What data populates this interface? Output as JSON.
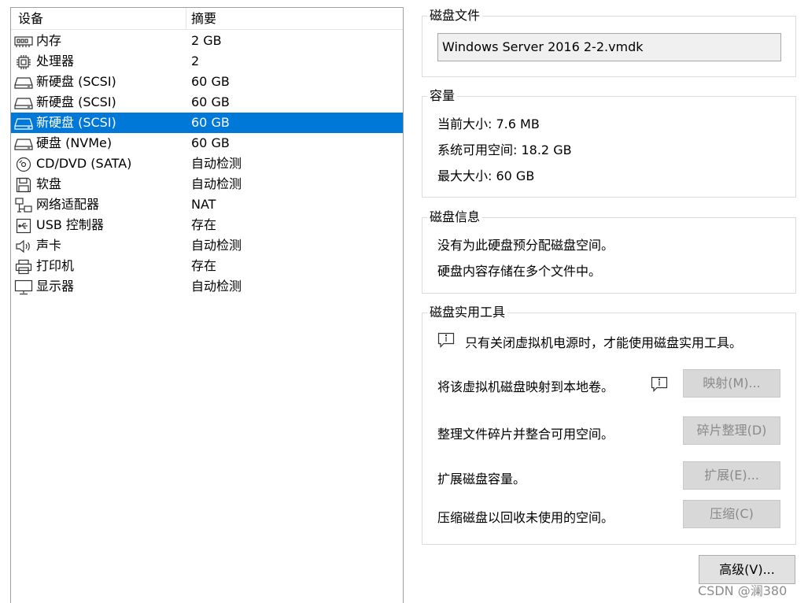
{
  "device_list": {
    "header": {
      "device": "设备",
      "summary": "摘要"
    },
    "rows": [
      {
        "icon": "memory-icon",
        "name": "内存",
        "summary": "2 GB",
        "selected": false
      },
      {
        "icon": "processor-icon",
        "name": "处理器",
        "summary": "2",
        "selected": false
      },
      {
        "icon": "hard-disk-icon",
        "name": "新硬盘 (SCSI)",
        "summary": "60 GB",
        "selected": false
      },
      {
        "icon": "hard-disk-icon",
        "name": "新硬盘 (SCSI)",
        "summary": "60 GB",
        "selected": false
      },
      {
        "icon": "hard-disk-icon",
        "name": "新硬盘 (SCSI)",
        "summary": "60 GB",
        "selected": true
      },
      {
        "icon": "hard-disk-icon",
        "name": "硬盘 (NVMe)",
        "summary": "60 GB",
        "selected": false
      },
      {
        "icon": "cd-dvd-icon",
        "name": "CD/DVD (SATA)",
        "summary": "自动检测",
        "selected": false
      },
      {
        "icon": "floppy-icon",
        "name": "软盘",
        "summary": "自动检测",
        "selected": false
      },
      {
        "icon": "network-adapter-icon",
        "name": "网络适配器",
        "summary": "NAT",
        "selected": false
      },
      {
        "icon": "usb-icon",
        "name": "USB 控制器",
        "summary": "存在",
        "selected": false
      },
      {
        "icon": "sound-card-icon",
        "name": "声卡",
        "summary": "自动检测",
        "selected": false
      },
      {
        "icon": "printer-icon",
        "name": "打印机",
        "summary": "存在",
        "selected": false
      },
      {
        "icon": "display-icon",
        "name": "显示器",
        "summary": "自动检测",
        "selected": false
      }
    ]
  },
  "disk_file": {
    "title": "磁盘文件",
    "value": "Windows Server 2016 2-2.vmdk"
  },
  "capacity": {
    "title": "容量",
    "current_size": "当前大小: 7.6 MB",
    "available_space": "系统可用空间: 18.2 GB",
    "max_size": "最大大小: 60 GB"
  },
  "disk_info": {
    "title": "磁盘信息",
    "line1": "没有为此硬盘预分配磁盘空间。",
    "line2": "硬盘内容存储在多个文件中。"
  },
  "disk_utilities": {
    "title": "磁盘实用工具",
    "notice": "只有关闭虚拟机电源时，才能使用磁盘实用工具。",
    "map_label": "将该虚拟机磁盘映射到本地卷。",
    "map_button": "映射(M)...",
    "defrag_label": "整理文件碎片并整合可用空间。",
    "defrag_button": "碎片整理(D)",
    "expand_label": "扩展磁盘容量。",
    "expand_button": "扩展(E)...",
    "compact_label": "压缩磁盘以回收未使用的空间。",
    "compact_button": "压缩(C)"
  },
  "advanced_button": "高级(V)...",
  "watermark": "CSDN @澜380",
  "colors": {
    "selection": "#0078d7",
    "disabled_button_bg": "#d8d8d8",
    "disabled_text": "#8a8a8a",
    "group_border": "#dcdcdc"
  }
}
